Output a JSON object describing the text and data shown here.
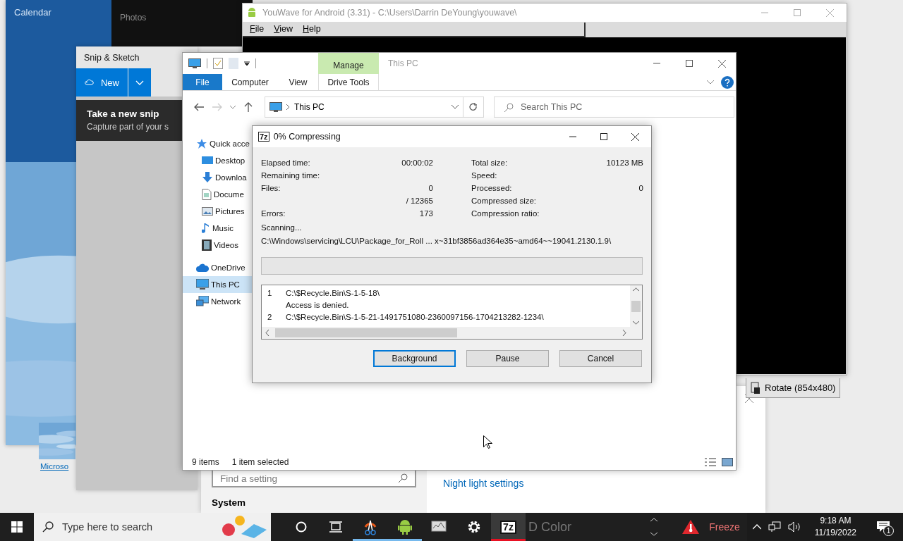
{
  "calendar": {
    "title": "Calendar"
  },
  "background_link": {
    "text": "Microso"
  },
  "photos": {
    "title": "Photos"
  },
  "youwave": {
    "title": "YouWave for Android (3.31) - C:\\Users\\Darrin DeYoung\\youwave\\",
    "menu": [
      "File",
      "View",
      "Help"
    ],
    "rotate_button": "Rotate (854x480)"
  },
  "settings": {
    "search": {
      "placeholder": "Find a setting"
    },
    "section": "System",
    "link": "Night light settings"
  },
  "snip_sketch": {
    "title": "Snip & Sketch",
    "new_button": "New",
    "tooltip": {
      "title": "Take a new snip",
      "text": "Capture part of your s"
    }
  },
  "explorer": {
    "context_group": "Manage",
    "title": "This PC",
    "ribbon_tabs": [
      {
        "label": "File",
        "selected": true
      },
      {
        "label": "Computer",
        "selected": false
      },
      {
        "label": "View",
        "selected": false
      },
      {
        "label": "Drive Tools",
        "selected": false
      }
    ],
    "address": "This PC",
    "search": {
      "placeholder": "Search This PC"
    },
    "nav": [
      {
        "label": "Quick acce",
        "kind": "star",
        "selected": false,
        "children": [
          {
            "label": "Desktop",
            "kind": "desktop",
            "selected": false
          },
          {
            "label": "Downloa",
            "kind": "download",
            "selected": false
          },
          {
            "label": "Docume",
            "kind": "document",
            "selected": false
          },
          {
            "label": "Pictures",
            "kind": "pictures",
            "selected": false
          },
          {
            "label": "Music",
            "kind": "music",
            "selected": false
          },
          {
            "label": "Videos",
            "kind": "videos",
            "selected": false
          }
        ]
      },
      {
        "label": "OneDrive",
        "kind": "cloud",
        "selected": false
      },
      {
        "label": "This PC",
        "kind": "pc",
        "selected": true
      },
      {
        "label": "Network",
        "kind": "network",
        "selected": false
      }
    ],
    "status": [
      "9 items",
      "1 item selected"
    ]
  },
  "zip": {
    "logo": "7z",
    "title": "0% Compressing",
    "stats_left": [
      {
        "label": "Elapsed time:",
        "value": "00:00:02"
      },
      {
        "label": "Remaining time:"
      },
      {
        "label": "Files:",
        "value": "0"
      },
      {
        "value": "/ 12365"
      },
      {
        "label": "Errors:",
        "value": "173"
      }
    ],
    "stats_right": [
      {
        "label": "Total size:",
        "value": "10123 MB"
      },
      {
        "label": "Speed:"
      },
      {
        "label": "Processed:",
        "value": "0"
      },
      {
        "label": "Compressed size:"
      },
      {
        "label": "Compression ratio:"
      }
    ],
    "status": "Scanning...",
    "current_path": "C:\\Windows\\servicing\\LCU\\Package_for_Roll ... x~31bf3856ad364e35~amd64~~19041.2130.1.9\\",
    "progress": {
      "level": 0
    },
    "log": [
      {
        "number": "1",
        "text": "C:\\$Recycle.Bin\\S-1-5-18\\"
      },
      {
        "text": "Access is denied."
      },
      {
        "number": "2",
        "text": "C:\\$Recycle.Bin\\S-1-5-21-1491751080-2360097156-1704213282-1234\\"
      }
    ],
    "buttons": [
      {
        "label": "Background",
        "focused": true
      },
      {
        "label": "Pause",
        "focused": false
      },
      {
        "label": "Cancel",
        "focused": false
      }
    ]
  },
  "taskbar": {
    "search": {
      "placeholder": "Type here to search"
    },
    "apps": [
      {
        "kind": "cortana",
        "active": false
      },
      {
        "kind": "taskview",
        "active": false
      },
      {
        "kind": "snip",
        "active": true
      },
      {
        "kind": "android",
        "active": true
      },
      {
        "kind": "monitor",
        "active": false
      },
      {
        "kind": "gear",
        "active": false
      },
      {
        "kind": "zip",
        "active": true,
        "logo": "7z"
      }
    ],
    "ghost_text": "D Color",
    "freeze": "Freeze",
    "time": "9:18 AM",
    "date": "11/19/2022",
    "notifications": "1"
  }
}
